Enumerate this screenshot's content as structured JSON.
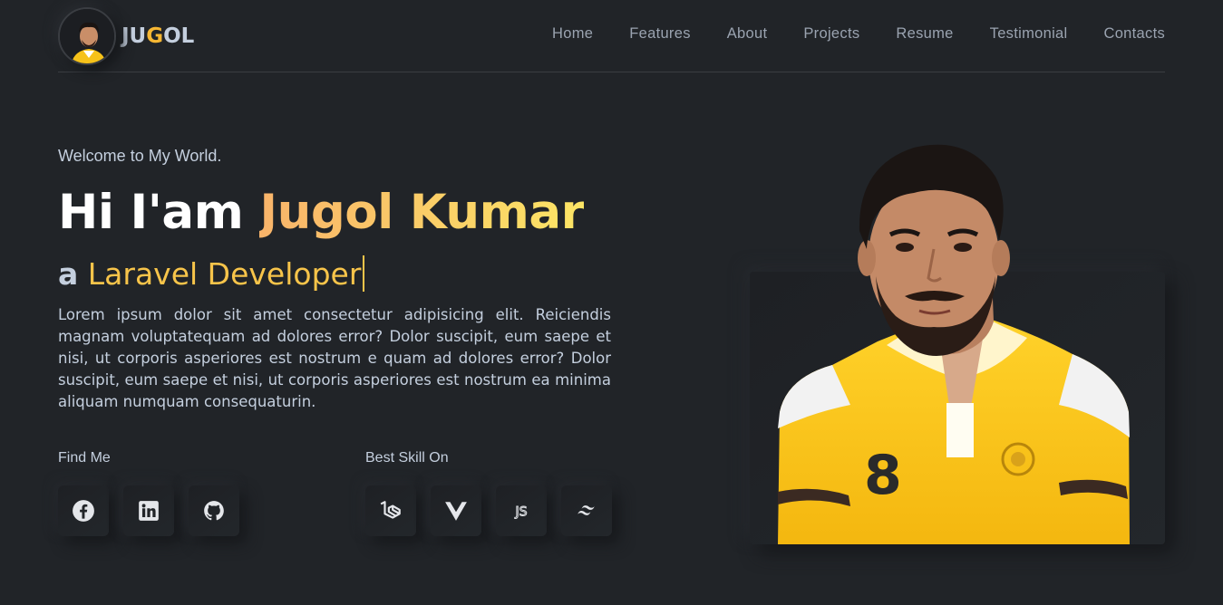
{
  "brand": {
    "name_start": "JU",
    "name_accent": "G",
    "name_end": "OL",
    "accent_color": "#f7b733"
  },
  "nav": {
    "items": [
      {
        "label": "Home"
      },
      {
        "label": "Features"
      },
      {
        "label": "About"
      },
      {
        "label": "Projects"
      },
      {
        "label": "Resume"
      },
      {
        "label": "Testimonial"
      },
      {
        "label": "Contacts"
      }
    ]
  },
  "hero": {
    "welcome": "Welcome to My World.",
    "greeting": "Hi I'am",
    "name": "Jugol Kumar",
    "role_prefix": "a",
    "role": "Laravel Developer",
    "description": "Lorem ipsum dolor sit amet consectetur adipisicing elit. Reiciendis magnam voluptatequam ad dolores error? Dolor suscipit, eum saepe et nisi, ut corporis asperiores est nostrum e quam ad dolores error? Dolor suscipit, eum saepe et nisi, ut corporis asperiores est nostrum ea minima aliquam numquam consequaturin."
  },
  "find_me": {
    "label": "Find Me",
    "icons": [
      "facebook-icon",
      "linkedin-icon",
      "github-icon"
    ]
  },
  "skills": {
    "label": "Best Skill On",
    "icons": [
      "laravel-icon",
      "vue-icon",
      "javascript-icon",
      "tailwind-icon"
    ]
  },
  "colors": {
    "background": "#212428",
    "text": "#c4cfde",
    "name_gradient_start": "#f9b46a",
    "name_gradient_end": "#fce565"
  }
}
